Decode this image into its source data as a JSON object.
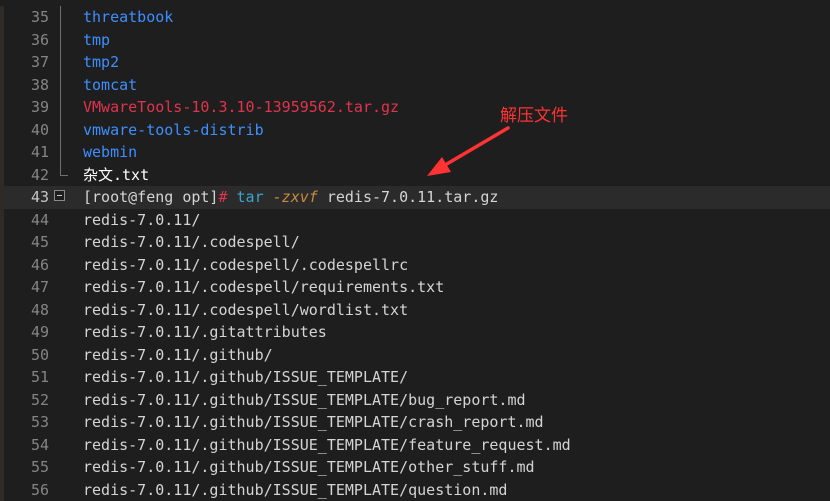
{
  "editor": {
    "lines": [
      {
        "no": "35",
        "text": "threatbook",
        "kind": "dir"
      },
      {
        "no": "36",
        "text": "tmp",
        "kind": "dir"
      },
      {
        "no": "37",
        "text": "tmp2",
        "kind": "dir"
      },
      {
        "no": "38",
        "text": "tomcat",
        "kind": "dir"
      },
      {
        "no": "39",
        "text": "VMwareTools-10.3.10-13959562.tar.gz",
        "kind": "archive"
      },
      {
        "no": "40",
        "text": "vmware-tools-distrib",
        "kind": "dir"
      },
      {
        "no": "41",
        "text": "webmin",
        "kind": "dir"
      },
      {
        "no": "42",
        "text": "杂文.txt",
        "kind": "text"
      },
      {
        "no": "43",
        "kind": "command",
        "prompt": "[root@feng opt]",
        "hash": "#",
        "cmd": "tar",
        "flag": "-zxvf",
        "arg": "redis-7.0.11.tar.gz"
      },
      {
        "no": "44",
        "text": "redis-7.0.11/",
        "kind": "plain"
      },
      {
        "no": "45",
        "text": "redis-7.0.11/.codespell/",
        "kind": "plain"
      },
      {
        "no": "46",
        "text": "redis-7.0.11/.codespell/.codespellrc",
        "kind": "plain"
      },
      {
        "no": "47",
        "text": "redis-7.0.11/.codespell/requirements.txt",
        "kind": "plain"
      },
      {
        "no": "48",
        "text": "redis-7.0.11/.codespell/wordlist.txt",
        "kind": "plain"
      },
      {
        "no": "49",
        "text": "redis-7.0.11/.gitattributes",
        "kind": "plain"
      },
      {
        "no": "50",
        "text": "redis-7.0.11/.github/",
        "kind": "plain"
      },
      {
        "no": "51",
        "text": "redis-7.0.11/.github/ISSUE_TEMPLATE/",
        "kind": "plain"
      },
      {
        "no": "52",
        "text": "redis-7.0.11/.github/ISSUE_TEMPLATE/bug_report.md",
        "kind": "plain"
      },
      {
        "no": "53",
        "text": "redis-7.0.11/.github/ISSUE_TEMPLATE/crash_report.md",
        "kind": "plain"
      },
      {
        "no": "54",
        "text": "redis-7.0.11/.github/ISSUE_TEMPLATE/feature_request.md",
        "kind": "plain"
      },
      {
        "no": "55",
        "text": "redis-7.0.11/.github/ISSUE_TEMPLATE/other_stuff.md",
        "kind": "plain"
      },
      {
        "no": "56",
        "text": "redis-7.0.11/.github/ISSUE_TEMPLATE/question.md",
        "kind": "plain"
      }
    ]
  },
  "annotation": {
    "label": "解压文件",
    "color": "#ff3333"
  },
  "colors": {
    "background": "#1e1e1e",
    "line_number": "#858585",
    "directory": "#3d8fff",
    "archive": "#e0344d",
    "command": "#3ba3d0",
    "flag": "#c98a3c",
    "gutter_marker": "#a0522d"
  }
}
